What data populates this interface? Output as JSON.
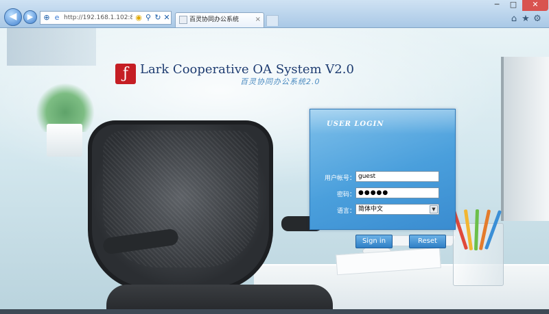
{
  "browser": {
    "address_url": "http://192.168.1.102:8",
    "tab_title": "百灵协同办公系统",
    "tab_close": "×",
    "window_controls": {
      "minimize": "─",
      "maximize": "□",
      "close": "✕"
    },
    "icons": [
      "back-icon",
      "forward-icon",
      "compatibility-icon",
      "search-icon",
      "refresh-icon",
      "stop-icon",
      "home-icon",
      "favorites-icon",
      "gear-icon"
    ]
  },
  "brand": {
    "english": "Lark Cooperative OA System V2.0",
    "chinese": "百灵协同办公系统2.0"
  },
  "login": {
    "title": "USER LOGIN",
    "username_label": "用户帐号：",
    "username_value": "guest",
    "password_label": "密码：",
    "password_value": "●●●●●",
    "language_label": "语言：",
    "language_selected": "简体中文",
    "sign_in": "Sign in",
    "reset": "Reset"
  },
  "colors": {
    "panel": "#4a9fdc",
    "button": "#2f7fc6",
    "logo": "#c51e24",
    "brand_text": "#1d3b70"
  }
}
